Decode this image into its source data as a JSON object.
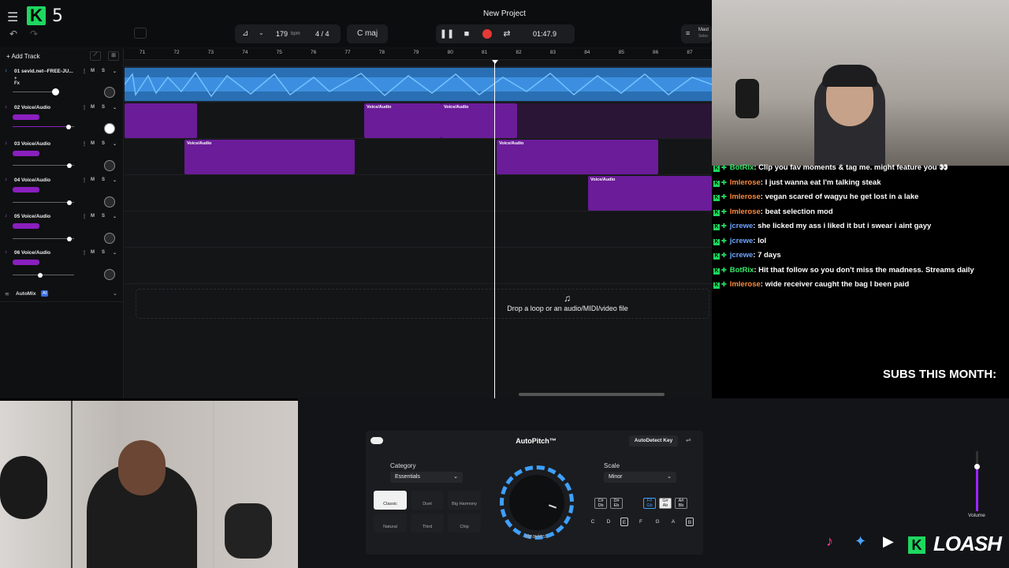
{
  "app": {
    "version": "5",
    "project_title": "New Project"
  },
  "transport": {
    "tempo": "179",
    "tempo_unit": "bpm",
    "time_sig": "4 / 4",
    "key": "C maj",
    "time": "01:47.9",
    "master": "Mast",
    "master_sub": "Selec"
  },
  "tracks_panel": {
    "add_track": "Add Track",
    "tracks": [
      {
        "name": "01 sevid.net--FREE-JU...",
        "sub": "+ Fx",
        "m": "M",
        "s": "S"
      },
      {
        "name": "02 Voice/Audio",
        "m": "M",
        "s": "S"
      },
      {
        "name": "03 Voice/Audio",
        "m": "M",
        "s": "S"
      },
      {
        "name": "04 Voice/Audio",
        "m": "M",
        "s": "S"
      },
      {
        "name": "05 Voice/Audio",
        "m": "M",
        "s": "S"
      },
      {
        "name": "06 Voice/Audio",
        "m": "M",
        "s": "S"
      }
    ],
    "automix": "AutoMix",
    "automix_badge": "AI"
  },
  "ruler": [
    "71",
    "72",
    "73",
    "74",
    "75",
    "76",
    "77",
    "78",
    "79",
    "80",
    "81",
    "82",
    "83",
    "84",
    "85",
    "86",
    "87"
  ],
  "clip_label": "Voice/Audio",
  "drop_text": "Drop a loop or an audio/MIDI/video file",
  "chat": [
    {
      "user": "BotRix",
      "msg": ": Clip you fav moments & tag me. might feature you 👀",
      "color": "green"
    },
    {
      "user": "lmlerose",
      "msg": ": I just wanna eat I'm talking steak",
      "color": "orange"
    },
    {
      "user": "lmlerose",
      "msg": ": vegan scared of wagyu he get lost in a lake",
      "color": "orange"
    },
    {
      "user": "lmlerose",
      "msg": ": beat selection mod",
      "color": "orange"
    },
    {
      "user": "jcrewe",
      "msg": ": she licked my ass i liked it but i swear i aint gayy",
      "color": "blue"
    },
    {
      "user": "jcrewe",
      "msg": ": lol",
      "color": "blue"
    },
    {
      "user": "jcrewe",
      "msg": ": 7 days",
      "color": "blue"
    },
    {
      "user": "BotRix",
      "msg": ": Hit that follow so you don't miss the madness. Streams daily",
      "color": "green"
    },
    {
      "user": "lmlerose",
      "msg": ": wide receiver caught the bag I been paid",
      "color": "orange"
    }
  ],
  "subs": "SUBS THIS MONTH:",
  "plugin": {
    "title": "AutoPitch™",
    "autodetect": "AutoDetect Key",
    "category_label": "Category",
    "category_value": "Essentials",
    "scale_label": "Scale",
    "scale_value": "Minor",
    "styles": [
      "Classic",
      "Duet",
      "Big Harmony",
      "Natural",
      "Third",
      "Chip"
    ],
    "dial_label": "Heaviest",
    "keys": [
      "C",
      "D",
      "E",
      "F",
      "G",
      "A",
      "B"
    ],
    "chords": [
      "C# Db",
      "D# Eb",
      "F# Gb",
      "G# Ab",
      "A# Bb"
    ]
  },
  "volume_label": "Volume",
  "brand": "LOASH"
}
